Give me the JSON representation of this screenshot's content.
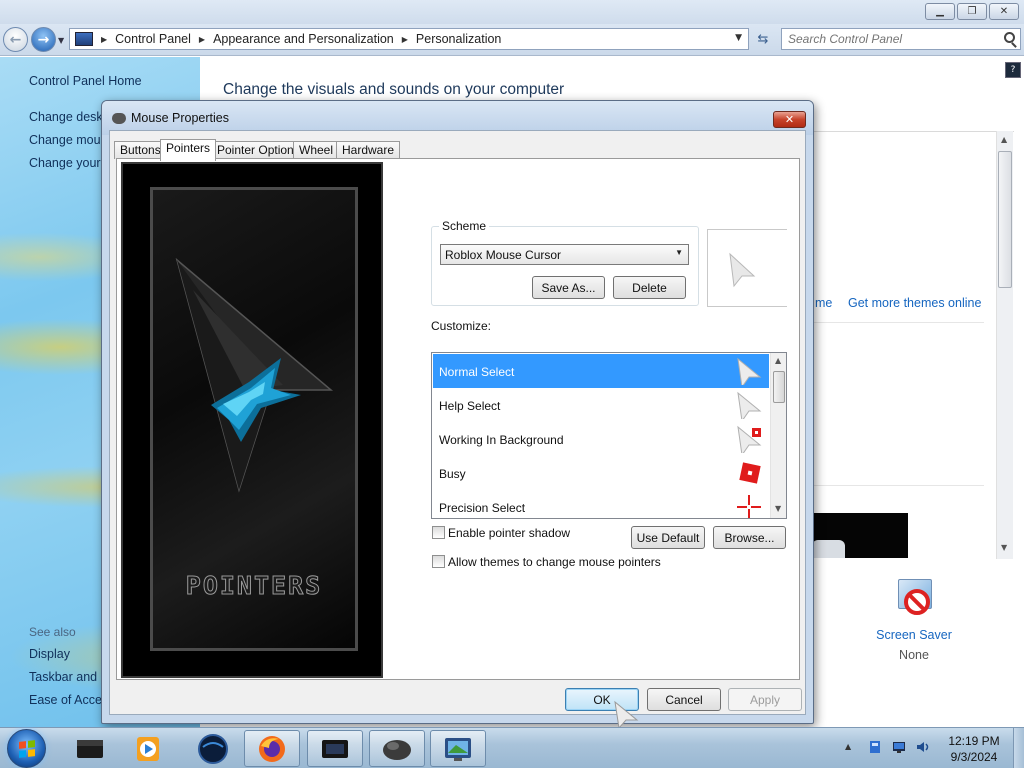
{
  "explorer": {
    "breadcrumb": [
      "Control Panel",
      "Appearance and Personalization",
      "Personalization"
    ],
    "search_placeholder": "Search Control Panel"
  },
  "sidebar": {
    "home": "Control Panel Home",
    "links": [
      "Change deskt",
      "Change mous",
      "Change your"
    ],
    "see_also_label": "See also",
    "see_also": [
      "Display",
      "Taskbar and S",
      "Ease of Acces"
    ]
  },
  "main": {
    "heading": "Change the visuals and sounds on your computer",
    "theme_link_partial": "me",
    "get_more_themes": "Get more themes online",
    "screen_saver_label": "Screen Saver",
    "screen_saver_value": "None"
  },
  "dialog": {
    "title": "Mouse Properties",
    "tabs": [
      "Buttons",
      "Pointers",
      "Pointer Options",
      "Wheel",
      "Hardware"
    ],
    "active_tab": "Pointers",
    "preview_word": "POINTERS",
    "scheme_label": "Scheme",
    "scheme_value": "Roblox Mouse Cursor",
    "save_as": "Save As...",
    "delete": "Delete",
    "customize_label": "Customize:",
    "cursors": [
      {
        "name": "Normal Select",
        "selected": true,
        "icon": "arrow-icon"
      },
      {
        "name": "Help Select",
        "selected": false,
        "icon": "arrow-icon"
      },
      {
        "name": "Working In Background",
        "selected": false,
        "icon": "working-icon"
      },
      {
        "name": "Busy",
        "selected": false,
        "icon": "busy-icon"
      },
      {
        "name": "Precision Select",
        "selected": false,
        "icon": "crosshair-icon"
      }
    ],
    "enable_shadow": "Enable pointer shadow",
    "use_default": "Use Default",
    "browse": "Browse...",
    "allow_themes": "Allow themes to change mouse pointers",
    "ok": "OK",
    "cancel": "Cancel",
    "apply": "Apply",
    "accent_select": "#3399ff",
    "accent_cursor_red": "#e01c1c"
  },
  "taskbar": {
    "apps": [
      "explorer-icon",
      "media-player-icon",
      "globe-icon",
      "firefox-icon",
      "window-icon",
      "mouse-icon",
      "control-panel-icon"
    ],
    "time": "12:19 PM",
    "date": "9/3/2024"
  }
}
